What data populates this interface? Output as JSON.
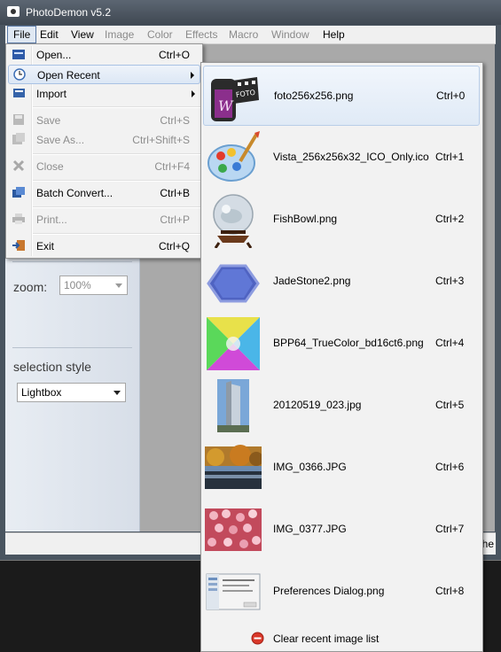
{
  "app": {
    "title": "PhotoDemon v5.2"
  },
  "menubar": [
    {
      "label": "File",
      "state": "active"
    },
    {
      "label": "Edit",
      "state": "enabled"
    },
    {
      "label": "View",
      "state": "enabled"
    },
    {
      "label": "Image",
      "state": "disabled"
    },
    {
      "label": "Color",
      "state": "disabled"
    },
    {
      "label": "Effects",
      "state": "disabled"
    },
    {
      "label": "Macro",
      "state": "disabled"
    },
    {
      "label": "Window",
      "state": "disabled"
    },
    {
      "label": "Help",
      "state": "enabled"
    }
  ],
  "panel": {
    "zoom_label": "zoom:",
    "zoom_value": "100%",
    "selection_label": "selection style",
    "selection_value": "Lightbox"
  },
  "status": {
    "text": "the"
  },
  "file_menu": {
    "items": [
      {
        "label": "Open...",
        "shortcut": "Ctrl+O",
        "icon": "open-icon"
      },
      {
        "label": "Open Recent",
        "shortcut": "",
        "icon": "recent-icon",
        "submenu": true
      },
      {
        "label": "Import",
        "shortcut": "",
        "icon": "import-icon",
        "submenu": true
      },
      {
        "label": "Save",
        "shortcut": "Ctrl+S",
        "icon": "save-icon",
        "disabled": true
      },
      {
        "label": "Save As...",
        "shortcut": "Ctrl+Shift+S",
        "icon": "save-as-icon",
        "disabled": true
      },
      {
        "label": "Close",
        "shortcut": "Ctrl+F4",
        "icon": "close-icon",
        "disabled": true
      },
      {
        "label": "Batch Convert...",
        "shortcut": "Ctrl+B",
        "icon": "batch-convert-icon"
      },
      {
        "label": "Print...",
        "shortcut": "Ctrl+P",
        "icon": "print-icon",
        "disabled": true
      },
      {
        "label": "Exit",
        "shortcut": "Ctrl+Q",
        "icon": "exit-icon"
      }
    ]
  },
  "recent_menu": {
    "items": [
      {
        "label": "foto256x256.png",
        "shortcut": "Ctrl+0",
        "thumb": "film-thumb"
      },
      {
        "label": "Vista_256x256x32_ICO_Only.ico",
        "shortcut": "Ctrl+1",
        "thumb": "palette-thumb"
      },
      {
        "label": "FishBowl.png",
        "shortcut": "Ctrl+2",
        "thumb": "fishbowl-thumb"
      },
      {
        "label": "JadeStone2.png",
        "shortcut": "Ctrl+3",
        "thumb": "hexagon-thumb"
      },
      {
        "label": "BPP64_TrueColor_bd16ct6.png",
        "shortcut": "Ctrl+4",
        "thumb": "color-gradient-thumb"
      },
      {
        "label": "20120519_023.jpg",
        "shortcut": "Ctrl+5",
        "thumb": "building-thumb"
      },
      {
        "label": "IMG_0366.JPG",
        "shortcut": "Ctrl+6",
        "thumb": "autumn-river-thumb"
      },
      {
        "label": "IMG_0377.JPG",
        "shortcut": "Ctrl+7",
        "thumb": "pink-flowers-thumb"
      },
      {
        "label": "Preferences Dialog.png",
        "shortcut": "Ctrl+8",
        "thumb": "dialog-thumb"
      }
    ],
    "clear_label": "Clear recent image list"
  }
}
